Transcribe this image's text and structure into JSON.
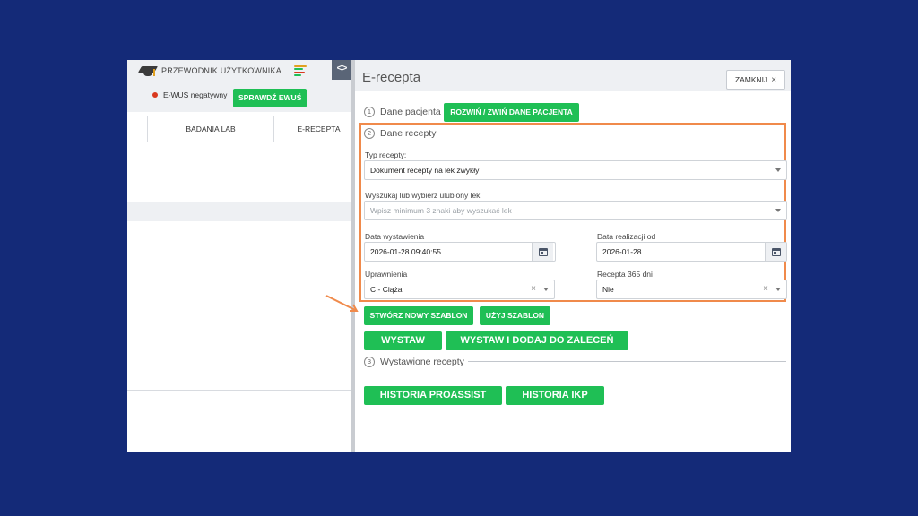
{
  "left_app": {
    "guide_label": "PRZEWODNIK UŻYTKOWNIKA",
    "ewus_status": "E-WUS negatywny",
    "sprawdz_label": "SPRAWDŹ EWUŚ",
    "tabs": [
      "BADANIA LAB",
      "E-RECEPTA"
    ],
    "toggle_label": "<>"
  },
  "panel": {
    "title": "E-recepta",
    "close_label": "ZAMKNIJ",
    "step1": {
      "num": "1",
      "label": "Dane pacjenta",
      "button": "ROZWIŃ / ZWIŃ DANE PACJENTA"
    },
    "step2": {
      "num": "2",
      "label": "Dane recepty"
    },
    "typ_recepty": {
      "label": "Typ recepty:",
      "value": "Dokument recepty na lek zwykły"
    },
    "wyszukaj": {
      "label": "Wyszukaj lub wybierz ulubiony lek:",
      "placeholder": "Wpisz minimum 3 znaki aby wyszukać lek"
    },
    "data_wystawienia": {
      "label": "Data wystawienia",
      "value": "2026-01-28 09:40:55"
    },
    "data_realizacji": {
      "label": "Data realizacji od",
      "value": "2026-01-28"
    },
    "uprawnienia": {
      "label": "Uprawnienia",
      "value": "C - Ciąża"
    },
    "recepta365": {
      "label": "Recepta 365 dni",
      "value": "Nie"
    },
    "btn_stworz": "STWÓRZ NOWY SZABLON",
    "btn_uzyj": "UŻYJ SZABLON",
    "btn_wystaw": "WYSTAW",
    "btn_wystaw_dodaj": "WYSTAW I DODAJ DO ZALECEŃ",
    "step3": {
      "num": "3",
      "label": "Wystawione recepty"
    },
    "btn_historia_proassist": "HISTORIA PROASSIST",
    "btn_historia_ikp": "HISTORIA IKP"
  },
  "colors": {
    "background": "#142a78",
    "green": "#1fbf55",
    "highlight": "#f08a4b"
  }
}
